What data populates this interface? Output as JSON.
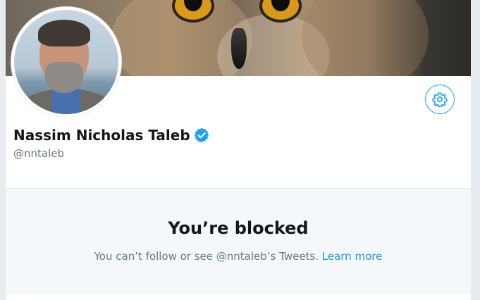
{
  "profile": {
    "display_name": "Nassim Nicholas Taleb",
    "handle": "@nntaleb",
    "verified": true
  },
  "blocked": {
    "title": "You’re blocked",
    "message": "You can’t follow or see @nntaleb’s Tweets.",
    "link": "Learn more"
  },
  "colors": {
    "accent": "#1da1f2",
    "link": "#1b95e0",
    "text": "#14171a",
    "muted": "#657786",
    "blocked_bg": "#f5f8fa"
  },
  "icons": {
    "settings": "gear-icon",
    "verified": "verified-badge-icon"
  }
}
